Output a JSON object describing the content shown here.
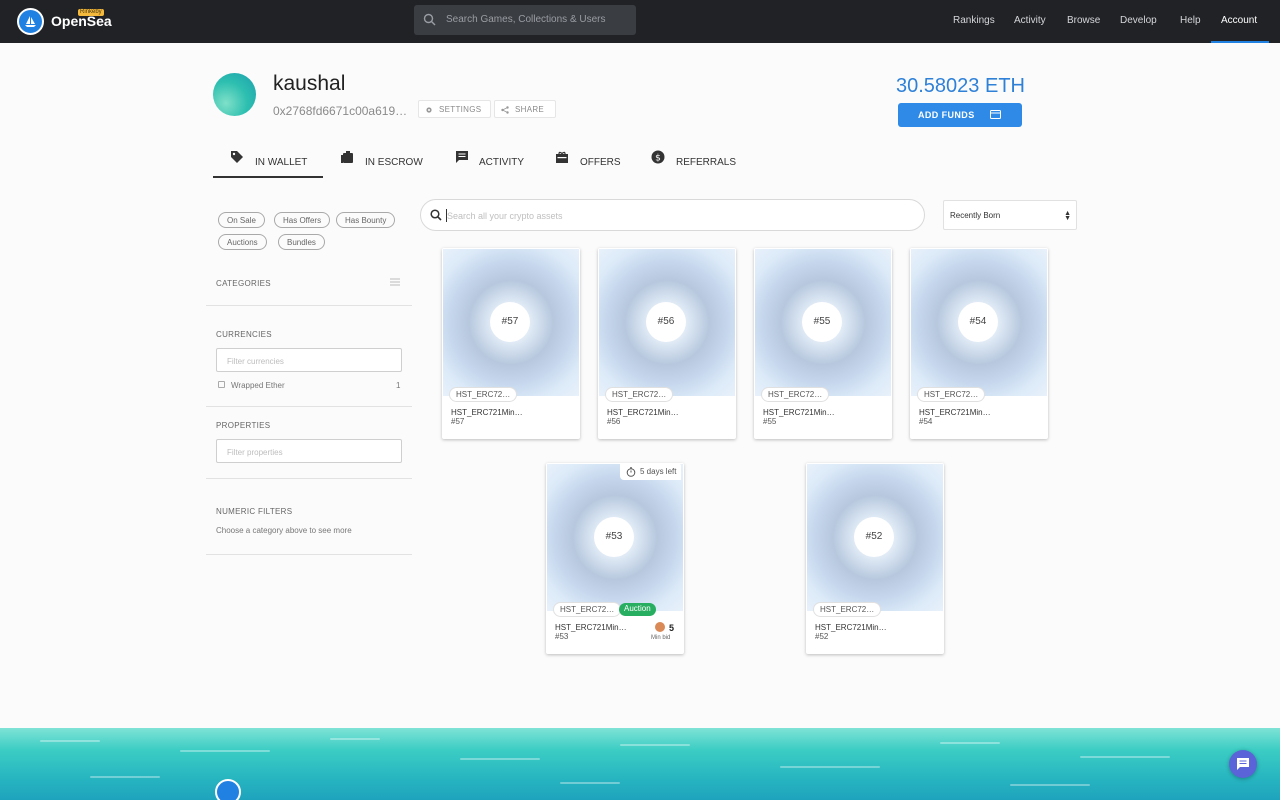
{
  "header": {
    "brand": "OpenSea",
    "network_badge": "Rinkeby",
    "search_placeholder": "Search Games, Collections & Users",
    "nav": [
      "Rankings",
      "Activity",
      "Browse",
      "Develop",
      "Help",
      "Account"
    ],
    "active_nav": "Account"
  },
  "profile": {
    "username": "kaushal",
    "address": "0x2768fd6671c00a619…",
    "settings_label": "SETTINGS",
    "share_label": "SHARE",
    "balance": "30.58023 ETH",
    "add_funds_label": "ADD FUNDS"
  },
  "tabs": [
    {
      "label": "IN WALLET",
      "icon": "tag-icon",
      "active": true
    },
    {
      "label": "IN ESCROW",
      "icon": "escrow-icon",
      "active": false
    },
    {
      "label": "ACTIVITY",
      "icon": "activity-icon",
      "active": false
    },
    {
      "label": "OFFERS",
      "icon": "offers-icon",
      "active": false
    },
    {
      "label": "REFERRALS",
      "icon": "dollar-icon",
      "active": false
    }
  ],
  "sidebar": {
    "chips": [
      "On Sale",
      "Has Offers",
      "Has Bounty",
      "Auctions",
      "Bundles"
    ],
    "categories_title": "CATEGORIES",
    "currencies_title": "CURRENCIES",
    "currencies_placeholder": "Filter currencies",
    "currency_items": [
      {
        "label": "Wrapped Ether",
        "count": "1"
      }
    ],
    "properties_title": "PROPERTIES",
    "properties_placeholder": "Filter properties",
    "numeric_title": "NUMERIC FILTERS",
    "numeric_hint": "Choose a category above to see more"
  },
  "main": {
    "search_placeholder": "Search all your crypto assets",
    "sort_value": "Recently Born"
  },
  "assets": [
    {
      "badge": "#57",
      "collection": "HST_ERC72…",
      "name": "HST_ERC721Min…",
      "id": "#57"
    },
    {
      "badge": "#56",
      "collection": "HST_ERC72…",
      "name": "HST_ERC721Min…",
      "id": "#56"
    },
    {
      "badge": "#55",
      "collection": "HST_ERC72…",
      "name": "HST_ERC721Min…",
      "id": "#55"
    },
    {
      "badge": "#54",
      "collection": "HST_ERC72…",
      "name": "HST_ERC721Min…",
      "id": "#54"
    },
    {
      "badge": "#53",
      "collection": "HST_ERC72…",
      "name": "HST_ERC721Min…",
      "id": "#53",
      "auction_label": "Auction",
      "timer": "5 days left",
      "min_bid": "5",
      "min_bid_label": "Min bid"
    },
    {
      "badge": "#52",
      "collection": "HST_ERC72…",
      "name": "HST_ERC721Min…",
      "id": "#52"
    }
  ],
  "colors": {
    "nav_bg": "#202225",
    "accent": "#2081e2",
    "balance": "#2f81d8",
    "auction_green": "#27ae60",
    "chat": "#5a64d8"
  }
}
